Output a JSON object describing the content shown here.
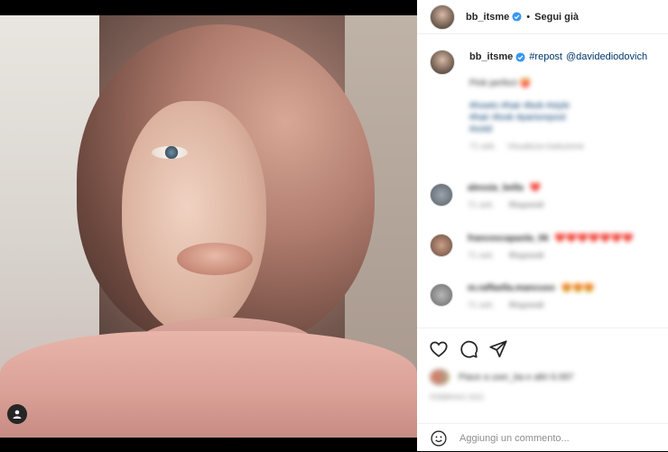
{
  "header": {
    "username": "bb_itsme",
    "separator": "•",
    "follow_label": "Segui già"
  },
  "caption": {
    "username": "bb_itsme",
    "repost_tag": "#repost",
    "mention": "@davidediodovich",
    "text_blurred": "Pink perfect 🍑",
    "hashtags_blurred_1": "#howto #hair #bob #style",
    "hashtags_blurred_2": "#hair #look #parisrepost",
    "hashtags_blurred_3": "#ootd",
    "meta_time": "71 sett.",
    "meta_translation": "Visualizza traduzione"
  },
  "comments": [
    {
      "username": "alessia_bella",
      "text": "❤️",
      "time": "71 sett.",
      "reply": "Rispondi"
    },
    {
      "username": "francescapaola_06",
      "text": "❤️❤️❤️❤️❤️❤️❤️",
      "time": "71 sett.",
      "reply": "Rispondi"
    },
    {
      "username": "m.raffaella.mancuso",
      "text": "😍😍😍",
      "time": "71 sett.",
      "reply": "Rispondi"
    }
  ],
  "likes": {
    "text_blurred": "Piace a user_ba e altri 6.097",
    "date_blurred": "FEBBRAIO 2021"
  },
  "comment_input": {
    "placeholder": "Aggiungi un commento..."
  },
  "colors": {
    "verified_blue": "#3897f0",
    "link_blue": "#00376b",
    "text_dark": "#262626",
    "text_muted": "#8e8e8e"
  },
  "icons": [
    "heart-icon",
    "comment-icon",
    "share-icon",
    "emoji-icon",
    "verified-icon",
    "user-tag-icon"
  ]
}
